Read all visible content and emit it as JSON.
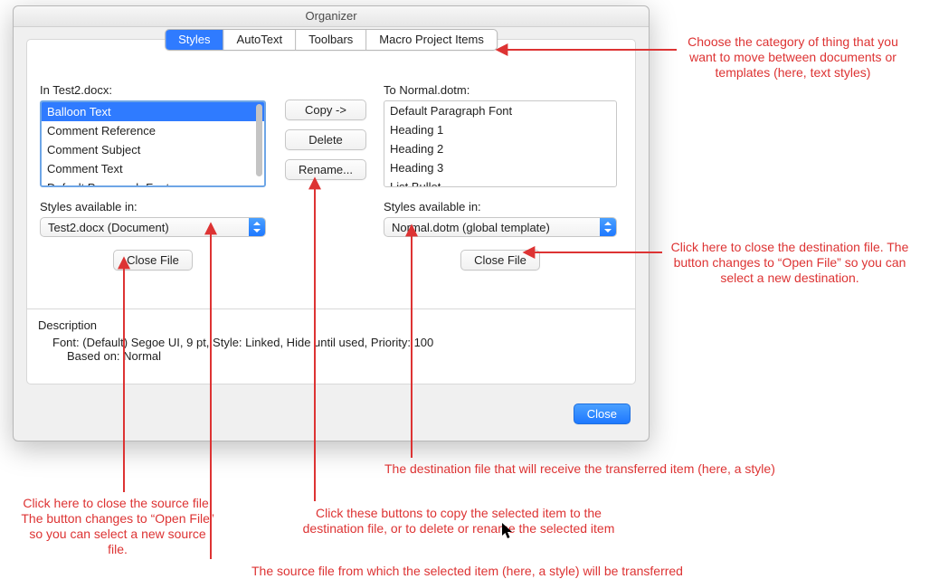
{
  "window": {
    "title": "Organizer"
  },
  "tabs": {
    "items": [
      {
        "label": "Styles",
        "active": true
      },
      {
        "label": "AutoText",
        "active": false
      },
      {
        "label": "Toolbars",
        "active": false
      },
      {
        "label": "Macro Project Items",
        "active": false
      }
    ]
  },
  "left": {
    "heading": "In Test2.docx:",
    "items": [
      "Balloon Text",
      "Comment Reference",
      "Comment Subject",
      "Comment Text",
      "Default Paragraph Font"
    ],
    "selected_index": 0,
    "available_label": "Styles available in:",
    "select_value": "Test2.docx (Document)",
    "close_label": "Close File"
  },
  "mid": {
    "copy_label": "Copy ->",
    "delete_label": "Delete",
    "rename_label": "Rename..."
  },
  "right": {
    "heading": "To Normal.dotm:",
    "items": [
      "Default Paragraph Font",
      "Heading 1",
      "Heading 2",
      "Heading 3",
      "List Bullet"
    ],
    "available_label": "Styles available in:",
    "select_value": "Normal.dotm (global template)",
    "close_label": "Close File"
  },
  "description": {
    "heading": "Description",
    "line1": "Font: (Default) Segoe UI, 9 pt, Style: Linked, Hide until used, Priority: 100",
    "line2": "Based on: Normal"
  },
  "footer": {
    "close_label": "Close"
  },
  "annotations": {
    "tabs": "Choose the category of thing that you want to move between documents or templates (here, text styles)",
    "right_close": "Click here to close the destination file. The button changes to “Open File” so you can select a new destination.",
    "dest_file": "The destination file that will receive the transferred item (here, a style)",
    "buttons": "Click these buttons to copy the selected item to the destination file, or to delete or rename the selected item",
    "source_file": "The source file from which the selected item (here, a style) will be transferred",
    "left_close": "Click here to close the source file. The button changes to “Open File” so you can select a new source file."
  },
  "colors": {
    "accent": "#2f7bff",
    "anno": "#d33"
  }
}
